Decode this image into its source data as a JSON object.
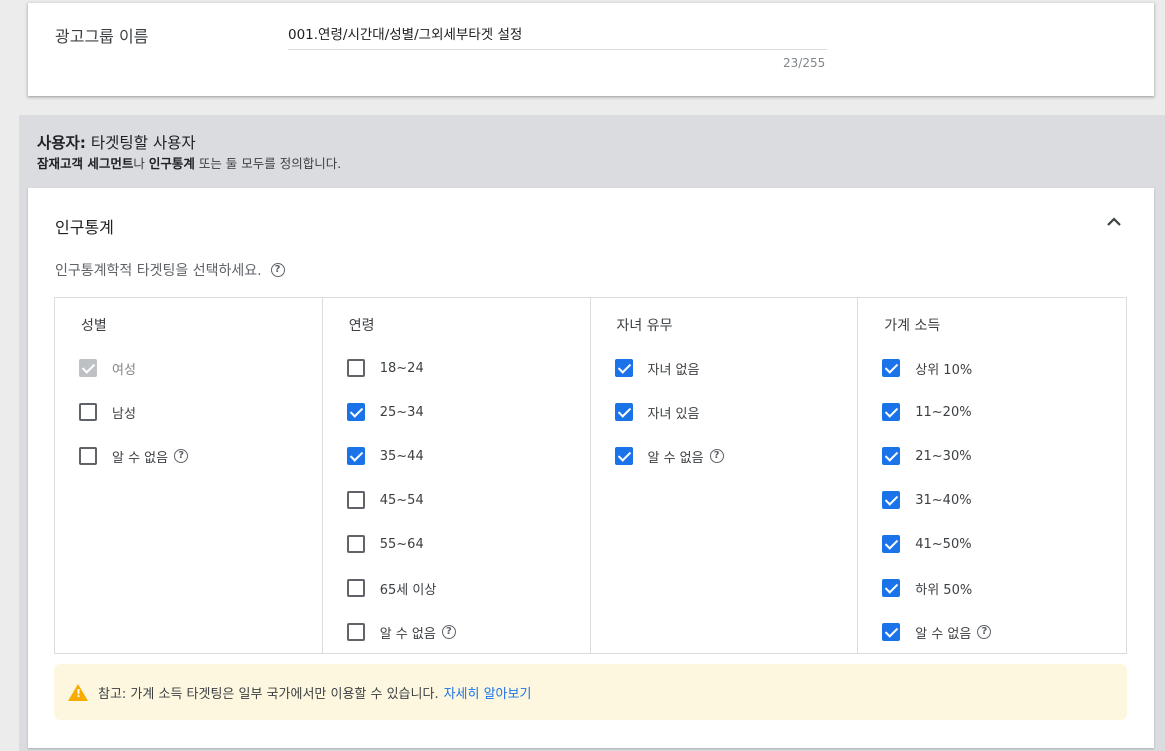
{
  "ad_group": {
    "label": "광고그룹 이름",
    "value": "001.연령/시간대/성별/그외세부타겟 설정",
    "counter": "23/255"
  },
  "audience": {
    "title_bold": "사용자:",
    "title_rest": " 타겟팅할 사용자",
    "sub_bold1": "잠재고객 세그먼트",
    "sub_text1": "나 ",
    "sub_bold2": "인구통계",
    "sub_text2": " 또는 둘 모두를 정의합니다."
  },
  "demographics": {
    "title": "인구통계",
    "description": "인구통계학적 타겟팅을 선택하세요.",
    "columns": [
      {
        "header": "성별",
        "options": [
          {
            "label": "여성",
            "state": "disabled"
          },
          {
            "label": "남성",
            "state": "off"
          },
          {
            "label": "알 수 없음",
            "state": "off",
            "help": true
          }
        ]
      },
      {
        "header": "연령",
        "options": [
          {
            "label": "18~24",
            "state": "off"
          },
          {
            "label": "25~34",
            "state": "on"
          },
          {
            "label": "35~44",
            "state": "on"
          },
          {
            "label": "45~54",
            "state": "off"
          },
          {
            "label": "55~64",
            "state": "off"
          },
          {
            "label": "65세 이상",
            "state": "off"
          },
          {
            "label": "알 수 없음",
            "state": "off",
            "help": true
          }
        ]
      },
      {
        "header": "자녀 유무",
        "options": [
          {
            "label": "자녀 없음",
            "state": "on"
          },
          {
            "label": "자녀 있음",
            "state": "on"
          },
          {
            "label": "알 수 없음",
            "state": "on",
            "help": true
          }
        ]
      },
      {
        "header": "가계 소득",
        "options": [
          {
            "label": "상위 10%",
            "state": "on"
          },
          {
            "label": "11~20%",
            "state": "on"
          },
          {
            "label": "21~30%",
            "state": "on"
          },
          {
            "label": "31~40%",
            "state": "on"
          },
          {
            "label": "41~50%",
            "state": "on"
          },
          {
            "label": "하위 50%",
            "state": "on"
          },
          {
            "label": "알 수 없음",
            "state": "on",
            "help": true
          }
        ]
      }
    ],
    "note_text": "참고: 가계 소득 타겟팅은 일부 국가에서만 이용할 수 있습니다.",
    "note_link": "자세히 알아보기"
  },
  "icons": {
    "help": "help-circle-icon",
    "collapse": "chevron-up-icon",
    "warning": "warning-icon"
  },
  "colors": {
    "accent": "#1a73e8",
    "warning": "#f9ab00",
    "note_bg": "#fef7e0"
  }
}
